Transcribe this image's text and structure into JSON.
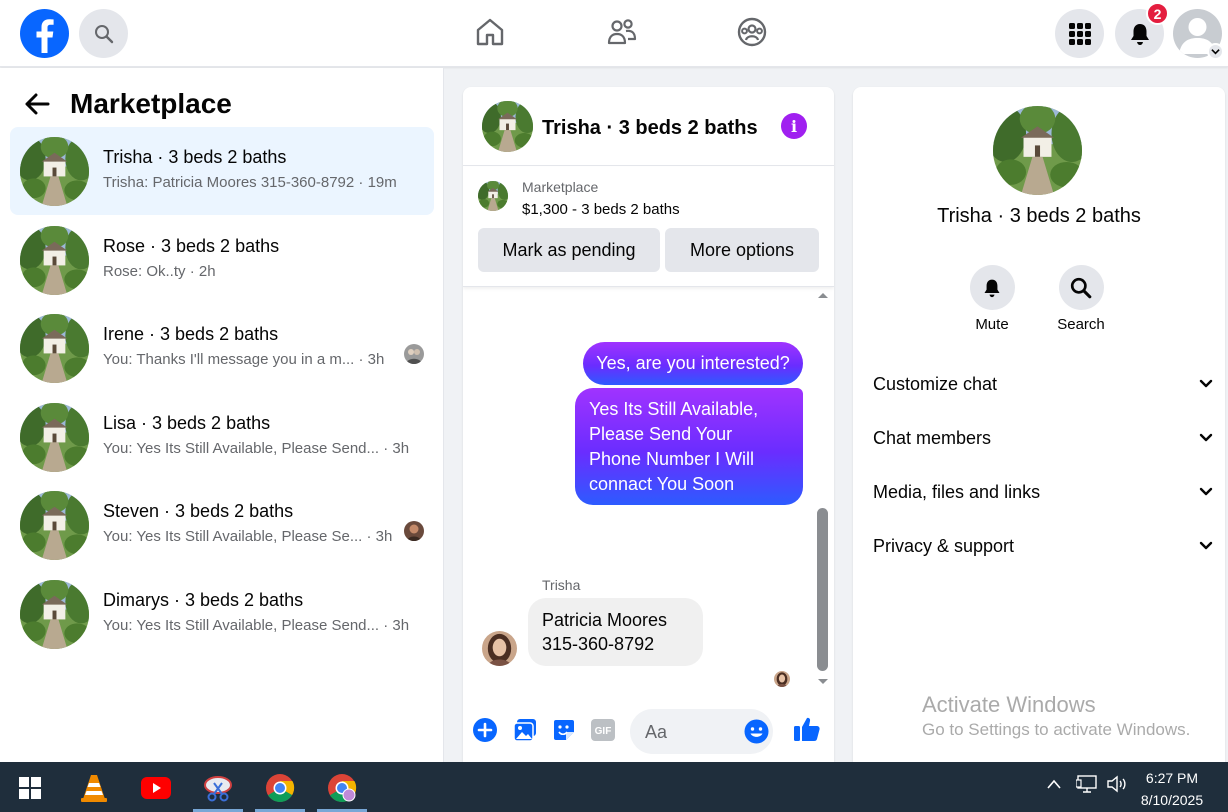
{
  "topbar": {
    "notifications_count": "2",
    "icons": [
      "facebook-logo-icon",
      "search-icon",
      "home-icon",
      "friends-icon",
      "groups-icon",
      "menu-grid-icon",
      "bell-icon",
      "profile-icon"
    ]
  },
  "marketplace": {
    "title": "Marketplace",
    "conversations": [
      {
        "name": "Trisha · 3 beds 2 baths",
        "snippet": "Trisha: Patricia Moores 315-360-8792 · 19m",
        "active": true
      },
      {
        "name": "Rose · 3 beds 2 baths",
        "snippet": "Rose: Ok..ty · 2h"
      },
      {
        "name": "Irene · 3 beds 2 baths",
        "snippet": "You: Thanks I'll message you in a m... · 3h"
      },
      {
        "name": "Lisa · 3 beds 2 baths",
        "snippet": "You: Yes Its Still Available, Please Send... · 3h"
      },
      {
        "name": "Steven · 3 beds 2 baths",
        "snippet": "You: Yes Its Still Available, Please Se... · 3h"
      },
      {
        "name": "Dimarys · 3 beds 2 baths",
        "snippet": "You: Yes Its Still Available, Please Send... · 3h"
      }
    ]
  },
  "chat": {
    "title": "Trisha · 3 beds 2 baths",
    "listing": {
      "source": "Marketplace",
      "detail": "$1,300 - 3 beds 2 baths",
      "mark_pending": "Mark as pending",
      "more_options": "More options"
    },
    "messages": {
      "out1": "Yes, are you interested?",
      "out2_lines": [
        "Yes Its Still Available,",
        "Please Send Your",
        "Phone Number I Will",
        "connact You Soon"
      ],
      "sender": "Trisha",
      "in1_lines": [
        "Patricia Moores",
        "315-360-8792"
      ]
    },
    "composer_placeholder": "Aa"
  },
  "details": {
    "title": "Trisha · 3 beds 2 baths",
    "mute_label": "Mute",
    "search_label": "Search",
    "sections": [
      "Customize chat",
      "Chat members",
      "Media, files and links",
      "Privacy & support"
    ]
  },
  "watermark": {
    "line1": "Activate Windows",
    "line2": "Go to Settings to activate Windows."
  },
  "taskbar": {
    "time": "6:27 PM",
    "date": "8/10/2025"
  },
  "colors": {
    "brand": "#0866ff",
    "accent_purple": "#a020f0",
    "active_row": "#ebf5ff",
    "badge": "#e41e3f"
  }
}
